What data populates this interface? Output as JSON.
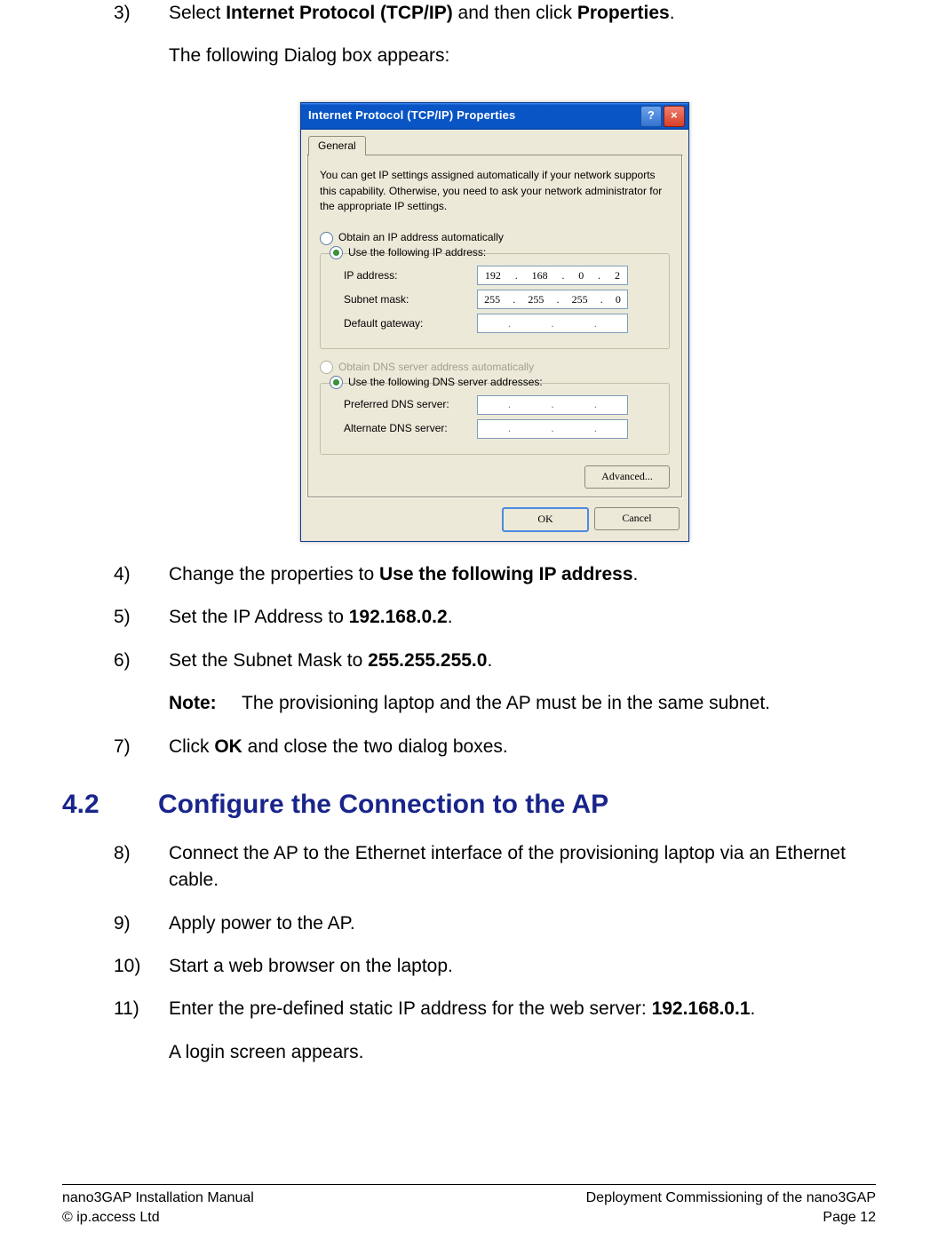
{
  "steps_a": [
    {
      "n": "3)",
      "html": "Select <b>Internet Protocol (TCP/IP)</b> and then click <b>Properties</b>.",
      "sub": "The following Dialog box appears:"
    },
    {
      "n": "4)",
      "html": "Change the properties to <b>Use the following IP address</b>."
    },
    {
      "n": "5)",
      "html": "Set the IP Address to <b>192.168.0.2</b>."
    },
    {
      "n": "6)",
      "html": "Set the Subnet Mask to <b>255.255.255.0</b>.",
      "note": "The provisioning laptop and the AP must be in the same subnet."
    },
    {
      "n": "7)",
      "html": "Click <b>OK</b> and close the two dialog boxes."
    }
  ],
  "section": {
    "num": "4.2",
    "title": "Configure the Connection to the AP"
  },
  "steps_b": [
    {
      "n": "8)",
      "html": "Connect the AP to the Ethernet interface of the provisioning laptop via an Ethernet cable."
    },
    {
      "n": "9)",
      "html": "Apply power to the AP."
    },
    {
      "n": "10)",
      "html": "Start a web browser on the laptop."
    },
    {
      "n": "11)",
      "html": "Enter the pre-defined static IP address for the web server: <b>192.168.0.1</b>.",
      "sub": "A login screen appears."
    }
  ],
  "note_label": "Note:",
  "dialog": {
    "title": "Internet Protocol (TCP/IP) Properties",
    "tab": "General",
    "intro": "You can get IP settings assigned automatically if your network supports this capability. Otherwise, you need to ask your network administrator for the appropriate IP settings.",
    "radio_auto_ip": "Obtain an IP address automatically",
    "radio_use_ip": "Use the following IP address:",
    "label_ip": "IP address:",
    "label_subnet": "Subnet mask:",
    "label_gateway": "Default gateway:",
    "radio_auto_dns": "Obtain DNS server address automatically",
    "radio_use_dns": "Use the following DNS server addresses:",
    "label_pref_dns": "Preferred DNS server:",
    "label_alt_dns": "Alternate DNS server:",
    "ip_value": [
      "192",
      "168",
      "0",
      "2"
    ],
    "subnet_value": [
      "255",
      "255",
      "255",
      "0"
    ],
    "btn_advanced": "Advanced...",
    "btn_ok": "OK",
    "btn_cancel": "Cancel",
    "help_glyph": "?",
    "close_glyph": "×"
  },
  "footer": {
    "l1_left": "nano3GAP Installation Manual",
    "l1_right": "Deployment Commissioning of the nano3GAP",
    "l2_left": "© ip.access Ltd",
    "l2_right": "Page 12"
  }
}
